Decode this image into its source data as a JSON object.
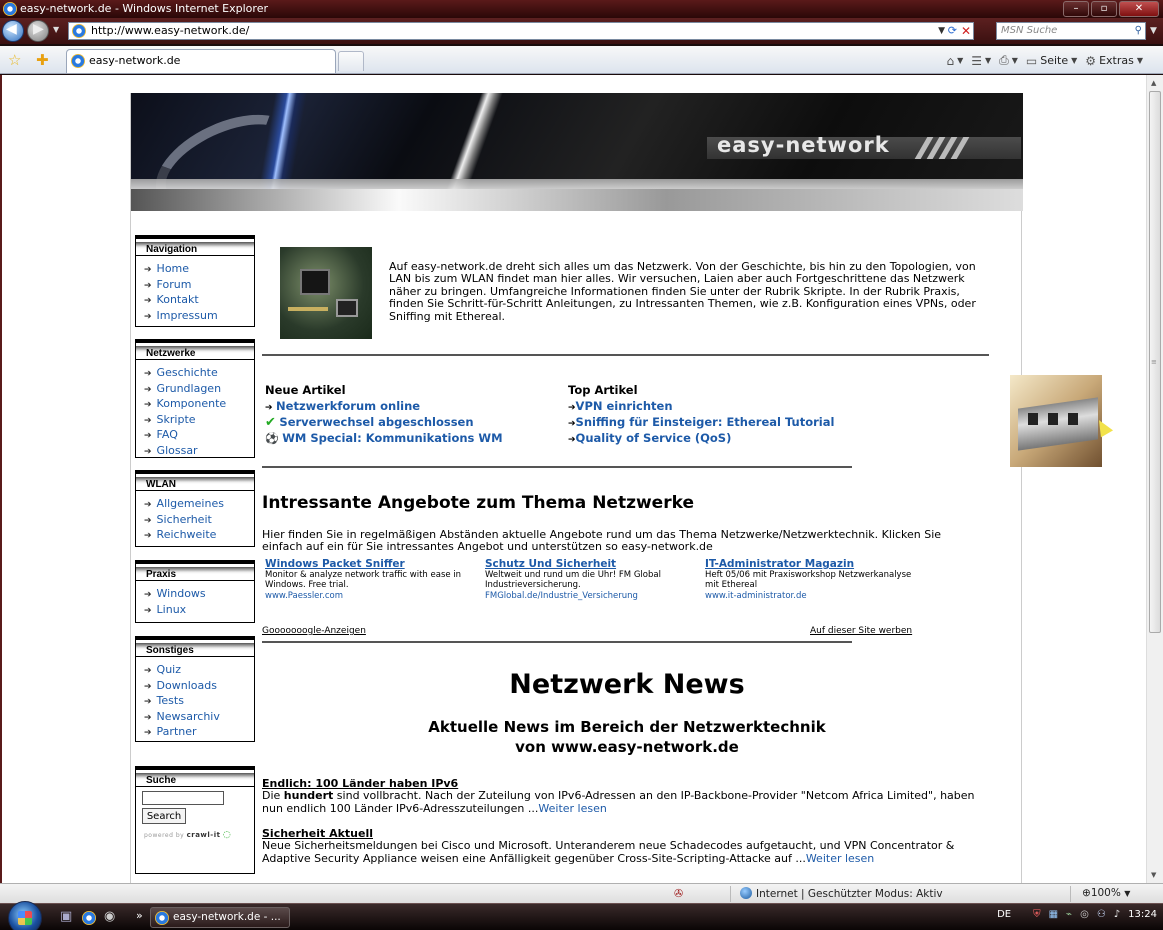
{
  "window": {
    "title": "easy-network.de - Windows Internet Explorer",
    "min_label": "–",
    "max_label": "▫",
    "close_label": "✕"
  },
  "address": {
    "url": "http://www.easy-network.de/",
    "search_placeholder": "MSN Suche"
  },
  "tab": {
    "title": "easy-network.de"
  },
  "commandbar": {
    "page_label": "Seite",
    "extras_label": "Extras"
  },
  "banner": {
    "logo": "easy-network"
  },
  "sidebar": {
    "boxes": [
      {
        "title": "Navigation",
        "items": [
          "Home",
          "Forum",
          "Kontakt",
          "Impressum"
        ]
      },
      {
        "title": "Netzwerke",
        "items": [
          "Geschichte",
          "Grundlagen",
          "Komponente",
          "Skripte",
          "FAQ",
          "Glossar"
        ]
      },
      {
        "title": "WLAN",
        "items": [
          "Allgemeines",
          "Sicherheit",
          "Reichweite"
        ]
      },
      {
        "title": "Praxis",
        "items": [
          "Windows",
          "Linux"
        ]
      },
      {
        "title": "Sonstiges",
        "items": [
          "Quiz",
          "Downloads",
          "Tests",
          "Newsarchiv",
          "Partner"
        ]
      }
    ],
    "search": {
      "title": "Suche",
      "button": "Search",
      "powered": "powered by",
      "brand": "crawl-it"
    }
  },
  "content": {
    "intro": "Auf easy-network.de dreht sich alles um das Netzwerk. Von der Geschichte, bis hin zu den Topologien, von LAN bis zum WLAN findet man hier alles. Wir versuchen, Laien aber auch Fortgeschrittene das Netzwerk näher zu bringen. Umfangreiche Informationen finden Sie unter der Rubrik Skripte. In der Rubrik Praxis, finden Sie Schritt-für-Schritt Anleitungen, zu Intressanten Themen, wie z.B. Konfiguration eines VPNs, oder Sniffing mit Ethereal.",
    "new_articles": {
      "heading": "Neue Artikel",
      "items": [
        "Netzwerkforum online",
        "Serverwechsel abgeschlossen",
        "WM Special: Kommunikations WM"
      ]
    },
    "top_articles": {
      "heading": "Top Artikel",
      "items": [
        "VPN einrichten",
        "Sniffing für Einsteiger: Ethereal Tutorial",
        "Quality of Service (QoS)"
      ]
    },
    "offers": {
      "heading": "Intressante Angebote zum Thema Netzwerke",
      "text": "Hier finden Sie in regelmäßigen Abständen aktuelle Angebote rund um das Thema Netzwerke/Netzwerktechnik. Klicken Sie einfach auf ein für Sie intressantes Angebot und unterstützen so easy-network.de",
      "ads": [
        {
          "title": "Windows Packet Sniffer",
          "desc": "Monitor & analyze network traffic with ease in Windows. Free trial.",
          "url": "www.Paessler.com"
        },
        {
          "title": "Schutz Und Sicherheit",
          "desc": "Weltweit und rund um die Uhr! FM Global Industrieversicherung.",
          "url": "FMGlobal.de/Industrie_Versicherung"
        },
        {
          "title": "IT-Administrator Magazin",
          "desc": "Heft 05/06 mit Praxisworkshop Netzwerkanalyse mit Ethereal",
          "url": "www.it-administrator.de"
        }
      ],
      "google": "Gooooooogle-Anzeigen",
      "advertise": "Auf dieser Site werben"
    },
    "news": {
      "heading": "Netzwerk News",
      "subheading1": "Aktuelle News im Bereich der Netzwerktechnik",
      "subheading2": "von www.easy-network.de",
      "items": [
        {
          "title": "Endlich: 100 Länder haben IPv6",
          "pre": "Die ",
          "bold": "hundert",
          "text": " sind vollbracht. Nach der Zuteilung von IPv6-Adressen an den IP-Backbone-Provider \"Netcom Africa Limited\", haben nun endlich 100 Länder IPv6-Adresszuteilungen ...",
          "more": "Weiter lesen"
        },
        {
          "title": "Sicherheit Aktuell",
          "pre": "",
          "bold": "",
          "text": "Neue Sicherheitsmeldungen bei Cisco und Microsoft. Unteranderem neue Schadecodes aufgetaucht, und VPN Concentrator & Adaptive Security Appliance weisen eine Anfälligkeit gegenüber Cross-Site-Scripting-Attacke auf ...",
          "more": "Weiter lesen"
        }
      ]
    }
  },
  "statusbar": {
    "zone": "Internet | Geschützter Modus: Aktiv",
    "zoom": "100%"
  },
  "taskbar": {
    "task_title": "easy-network.de - ...",
    "chevron": "»",
    "lang": "DE",
    "time": "13:24"
  }
}
